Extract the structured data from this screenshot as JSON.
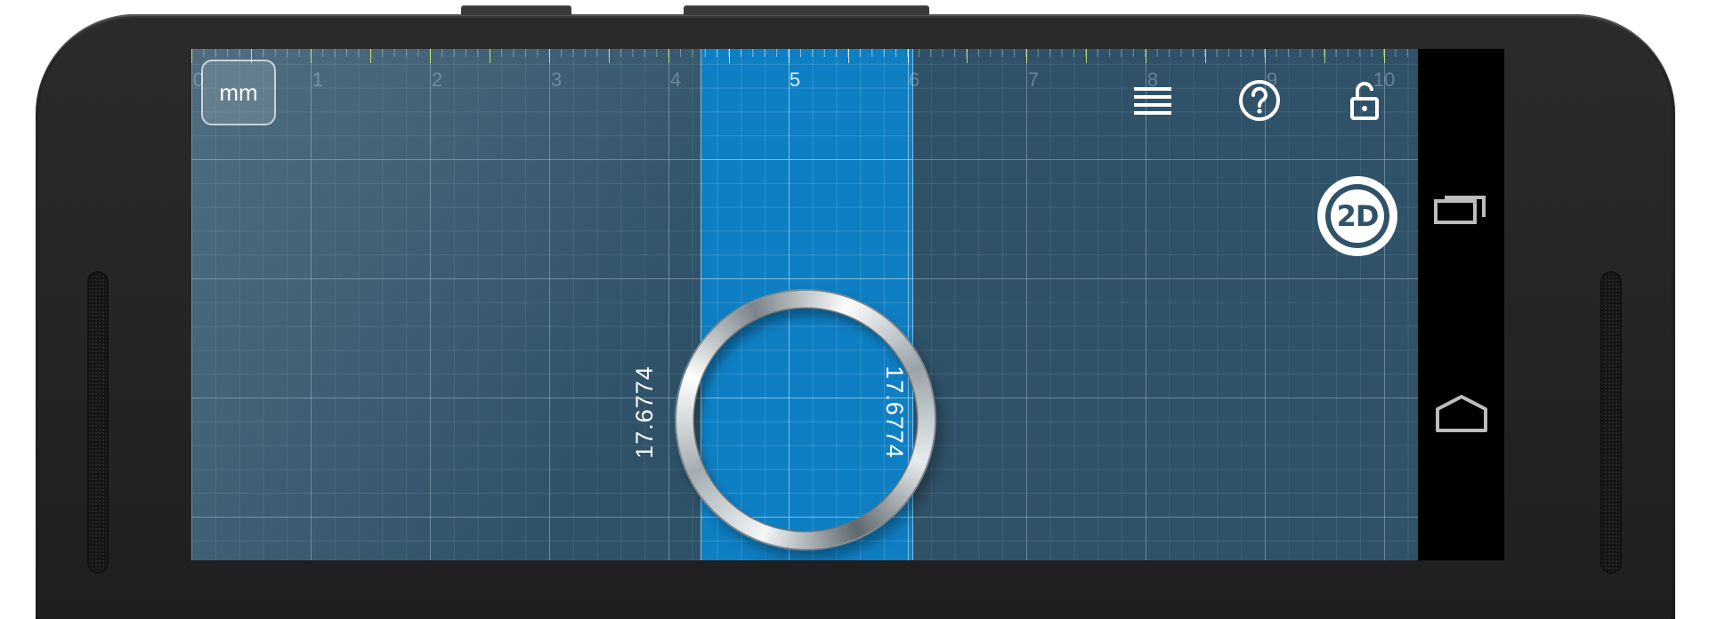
{
  "app": {
    "unit_label": "mm",
    "ruler_labels": [
      "0",
      "1",
      "2",
      "3",
      "4",
      "5",
      "6",
      "7",
      "8",
      "9",
      "10"
    ],
    "active_ruler_label": "5",
    "measurement_left": "17.6774",
    "measurement_right": "17.6774",
    "mode_badge": "2D",
    "icons": {
      "menu": "menu-icon",
      "help": "help-icon",
      "lock": "unlock-icon"
    },
    "colors": {
      "background": "#2f5268",
      "highlight_band": "#0e7fc3",
      "ruler_accent": "#d7eb78"
    }
  },
  "navbar": {
    "icons": [
      "recent-apps-icon",
      "home-icon"
    ]
  }
}
